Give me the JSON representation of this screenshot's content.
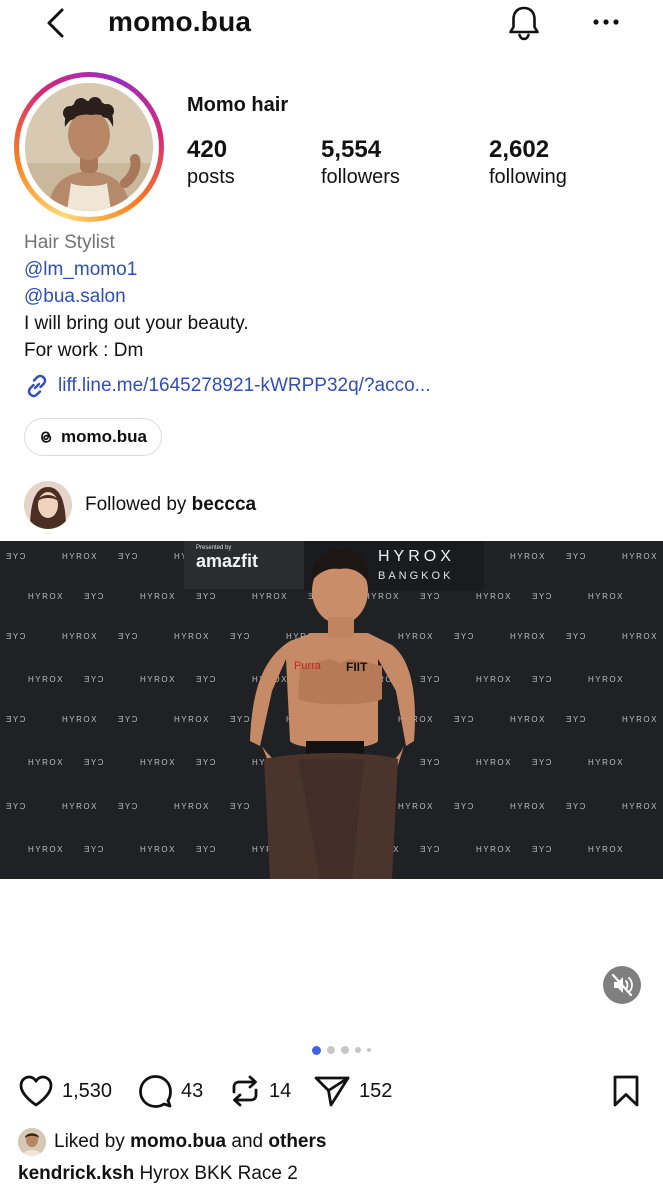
{
  "header": {
    "title": "momo.bua",
    "back_icon": "chevron-left-icon",
    "notifications_icon": "bell-icon",
    "more_icon": "more-horizontal-icon"
  },
  "profile": {
    "display_name": "Momo hair",
    "stats": [
      {
        "value": "420",
        "label": "posts"
      },
      {
        "value": "5,554",
        "label": "followers"
      },
      {
        "value": "2,602",
        "label": "following"
      }
    ],
    "category": "Hair Stylist",
    "mentions": [
      "@lm_momo1",
      "@bua.salon"
    ],
    "bio_lines": [
      "I will bring out your beauty.",
      "For work : Dm"
    ],
    "link": "liff.line.me/1645278921-kWRPP32q/?acco...",
    "threads_handle": "momo.bua",
    "followed_by_prefix": "Followed by",
    "followed_by_user": "beccca"
  },
  "post": {
    "backdrop_brands_row": [
      "ƎYƆ",
      "HYROX",
      "ƎYƆ",
      "HYROX",
      "ƎYƆ",
      "HYROX",
      "ƎYƆ",
      "HYROX",
      "ƎYƆ",
      "HYROX",
      "ƎYƆ",
      "HYROX"
    ],
    "banner_presented": "Presented by",
    "banner_brand": "amazfit",
    "banner_event": "HYROX",
    "banner_city": "BANGKOK",
    "carousel": {
      "count": 5,
      "active_index": 0
    },
    "likes": "1,530",
    "comments": "43",
    "reposts": "14",
    "shares": "152",
    "liked_by_prefix": "Liked by",
    "liked_by_user": "momo.bua",
    "liked_by_and": "and",
    "liked_by_others": "others",
    "caption_user": "kendrick.ksh",
    "caption_text": "Hyrox BKK Race 2"
  },
  "colors": {
    "link_blue": "#2f4fb3",
    "category_gray": "#737373",
    "dot_active": "#3f63e0",
    "dot_inactive": "#c7c7c7",
    "backdrop": "#1f2125"
  }
}
